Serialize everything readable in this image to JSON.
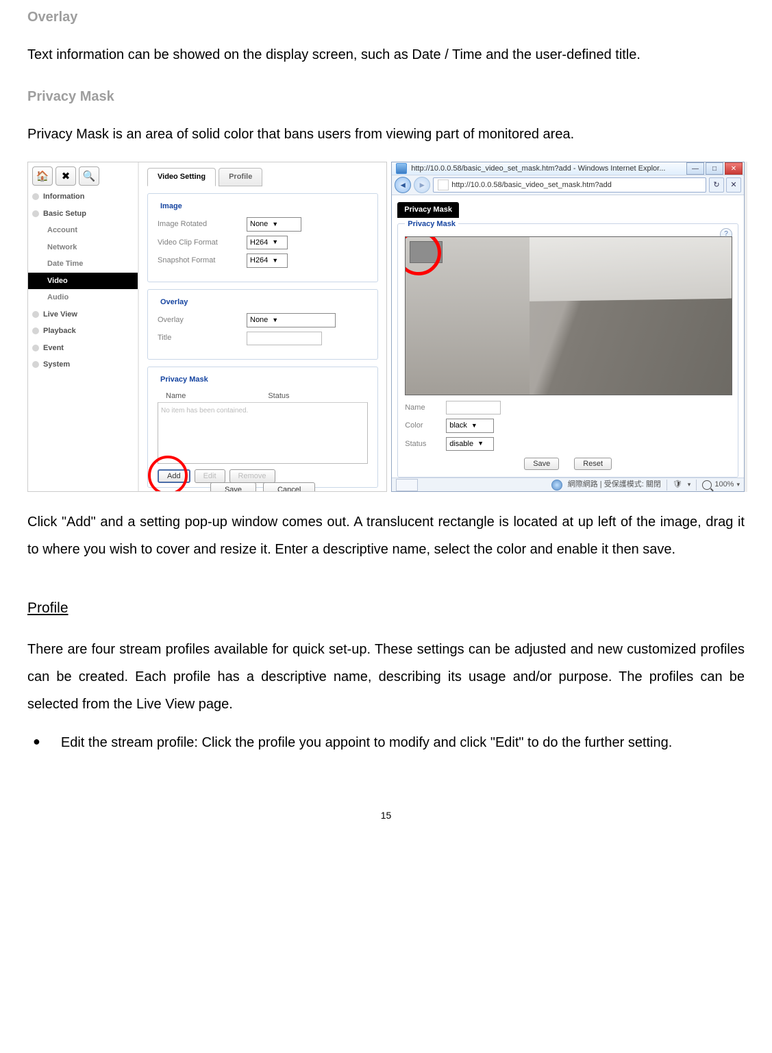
{
  "headings": {
    "overlay": "Overlay",
    "privacy": "Privacy Mask",
    "profile": "Profile"
  },
  "paragraphs": {
    "overlay_body": "Text information can be showed on the display screen, such as Date / Time and the user-defined title.",
    "privacy_body": "Privacy Mask is an area of solid color that bans users from viewing part of monitored area.",
    "after_shots": "Click \"Add\" and a setting pop-up window comes out. A translucent rectangle is located at up left of the image, drag it to where you wish to cover and resize it. Enter a descriptive name, select the color and enable it then save.",
    "profile_body": "There are four stream profiles available for quick set-up. These settings can be adjusted and new customized profiles can be created. Each profile has a descriptive name, describing its usage and/or purpose. The profiles can be selected from the Live View page."
  },
  "bullet": {
    "edit_stream": "Edit the stream profile: Click the profile you appoint to modify and click \"Edit\" to do the further setting."
  },
  "shot_left": {
    "sidebar": {
      "items": [
        {
          "label": "Information",
          "bullet": true
        },
        {
          "label": "Basic Setup",
          "bullet": true
        },
        {
          "label": "Account",
          "child": true
        },
        {
          "label": "Network",
          "child": true
        },
        {
          "label": "Date Time",
          "child": true
        },
        {
          "label": "Video",
          "child": true,
          "active": true
        },
        {
          "label": "Audio",
          "child": true
        },
        {
          "label": "Live View",
          "bullet": true
        },
        {
          "label": "Playback",
          "bullet": true
        },
        {
          "label": "Event",
          "bullet": true
        },
        {
          "label": "System",
          "bullet": true
        }
      ]
    },
    "tabs": {
      "video_setting": "Video Setting",
      "profile": "Profile"
    },
    "image_group": {
      "legend": "Image",
      "rotated_label": "Image Rotated",
      "rotated_value": "None",
      "clip_label": "Video Clip Format",
      "clip_value": "H264",
      "snap_label": "Snapshot Format",
      "snap_value": "H264"
    },
    "overlay_group": {
      "legend": "Overlay",
      "overlay_label": "Overlay",
      "overlay_value": "None",
      "title_label": "Title"
    },
    "mask_group": {
      "legend": "Privacy Mask",
      "name_col": "Name",
      "status_col": "Status",
      "empty_msg": "No item has been contained.",
      "add_btn": "Add",
      "edit_btn": "Edit",
      "remove_btn": "Remove"
    },
    "save_btn": "Save",
    "cancel_btn": "Cancel"
  },
  "shot_right": {
    "title": "http://10.0.0.58/basic_video_set_mask.htm?add - Windows Internet Explor...",
    "url": "http://10.0.0.58/basic_video_set_mask.htm?add",
    "tab_label": "Privacy Mask",
    "fieldset_legend": "Privacy Mask",
    "name_label": "Name",
    "color_label": "Color",
    "color_value": "black",
    "status_label": "Status",
    "status_value": "disable",
    "save_btn": "Save",
    "reset_btn": "Reset",
    "status_text": "網際網路 | 受保護模式: 關閉",
    "zoom": "100%"
  },
  "page_number": "15"
}
